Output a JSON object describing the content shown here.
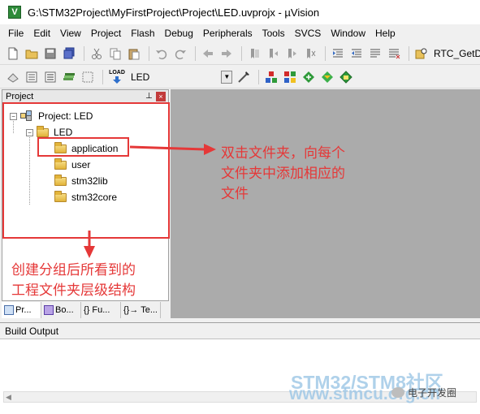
{
  "window": {
    "title": "G:\\STM32Project\\MyFirstProject\\Project\\LED.uvprojx - µVision",
    "app_icon": "V"
  },
  "menu": [
    "File",
    "Edit",
    "View",
    "Project",
    "Flash",
    "Debug",
    "Peripherals",
    "Tools",
    "SVCS",
    "Window",
    "Help"
  ],
  "toolbar1": {
    "icons": [
      "new-file-icon",
      "open-folder-icon",
      "save-icon",
      "save-all-icon",
      "cut-icon",
      "copy-icon",
      "paste-icon",
      "undo-icon",
      "redo-icon",
      "nav-back-icon",
      "nav-forward-icon",
      "bookmark-icon",
      "bookmark-prev-icon",
      "bookmark-next-icon",
      "bookmark-clear-icon",
      "indent-icon",
      "unindent-icon",
      "comment-icon",
      "uncomment-icon",
      "find-in-files-icon"
    ],
    "function_text": "RTC_GetD"
  },
  "toolbar2": {
    "icons": [
      "translate-icon",
      "build-icon",
      "rebuild-icon",
      "batch-build-icon",
      "stop-build-icon",
      "download-icon"
    ],
    "download_label": "LOAD",
    "target_name": "LED",
    "right_icons": [
      "target-options-icon",
      "manage-components-icon",
      "pack-installer-icon",
      "select-packs-icon",
      "manage-rte-icon"
    ]
  },
  "project_panel": {
    "title": "Project",
    "project_label": "Project: LED",
    "target_label": "LED",
    "groups": [
      "application",
      "user",
      "stm32lib",
      "stm32core"
    ],
    "tabs": [
      "Pr...",
      "Bo...",
      "{} Fu...",
      "{}→ Te..."
    ]
  },
  "annotations": {
    "right_note": [
      "双击文件夹，向每个",
      "文件夹中添加相应的",
      "文件"
    ],
    "bottom_note": [
      "创建分组后所看到的",
      "工程文件夹层级结构"
    ],
    "color": "#e53838"
  },
  "build_output": {
    "title": "Build Output"
  },
  "watermark": {
    "line1": "STM32/STM8社区",
    "line2": "www.stmcu.org.cn",
    "badge": "电子开发圈"
  }
}
